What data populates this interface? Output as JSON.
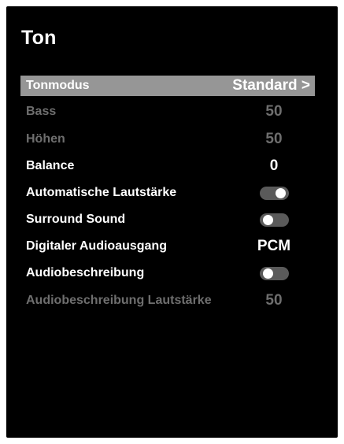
{
  "page": {
    "title": "Ton"
  },
  "menu": {
    "items": [
      {
        "label": "Tonmodus",
        "value": "Standard >"
      },
      {
        "label": "Bass",
        "value": "50"
      },
      {
        "label": "Höhen",
        "value": "50"
      },
      {
        "label": "Balance",
        "value": "0"
      },
      {
        "label": "Automatische Lautstärke",
        "toggle": "on"
      },
      {
        "label": "Surround Sound",
        "toggle": "off"
      },
      {
        "label": "Digitaler Audioausgang",
        "value": "PCM"
      },
      {
        "label": "Audiobeschreibung",
        "toggle": "off"
      },
      {
        "label": "Audiobeschreibung Lautstärke",
        "value": "50"
      }
    ]
  },
  "colors": {
    "background": "#000000",
    "highlight": "#969696",
    "text_active": "#ffffff",
    "text_disabled": "#6e6e6e",
    "toggle_track": "#5a5a5a"
  }
}
